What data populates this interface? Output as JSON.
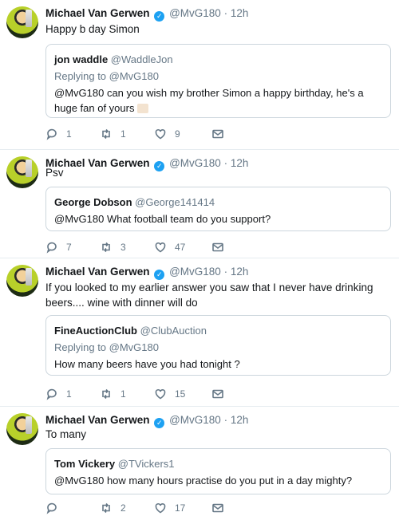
{
  "tweets": [
    {
      "author": "Michael Van Gerwen",
      "handle": "@MvG180",
      "time": "12h",
      "text": "Happy b day Simon",
      "quote": {
        "author": "jon waddle",
        "handle": "@WaddleJon",
        "replying_to": "Replying to @MvG180",
        "text": "@MvG180 can you wish my brother Simon a happy birthday, he's a huge fan of yours"
      },
      "counts": {
        "replies": "1",
        "retweets": "1",
        "likes": "9"
      }
    },
    {
      "author": "Michael Van Gerwen",
      "handle": "@MvG180",
      "time": "12h",
      "text": "Psv",
      "quote": {
        "author": "George Dobson",
        "handle": "@George141414",
        "replying_to": "",
        "text": "@MvG180 What football team do you support?"
      },
      "counts": {
        "replies": "7",
        "retweets": "3",
        "likes": "47"
      }
    },
    {
      "author": "Michael Van Gerwen",
      "handle": "@MvG180",
      "time": "12h",
      "text": "If you looked to my earlier answer you saw that I never have drinking beers.... wine with dinner will do",
      "quote": {
        "author": "FineAuctionClub",
        "handle": "@ClubAuction",
        "replying_to": "Replying to @MvG180",
        "text": "How many beers have you had tonight ?"
      },
      "counts": {
        "replies": "1",
        "retweets": "1",
        "likes": "15"
      }
    },
    {
      "author": "Michael Van Gerwen",
      "handle": "@MvG180",
      "time": "12h",
      "text": "To many",
      "quote": {
        "author": "Tom Vickery",
        "handle": "@TVickers1",
        "replying_to": "",
        "text": "@MvG180 how many hours practise do you put in a day mighty?"
      },
      "counts": {
        "replies": "",
        "retweets": "2",
        "likes": "17"
      }
    }
  ],
  "separator": "·",
  "colors": {
    "verified": "#1da1f2",
    "muted": "#657786",
    "border": "#ccd6dd"
  }
}
